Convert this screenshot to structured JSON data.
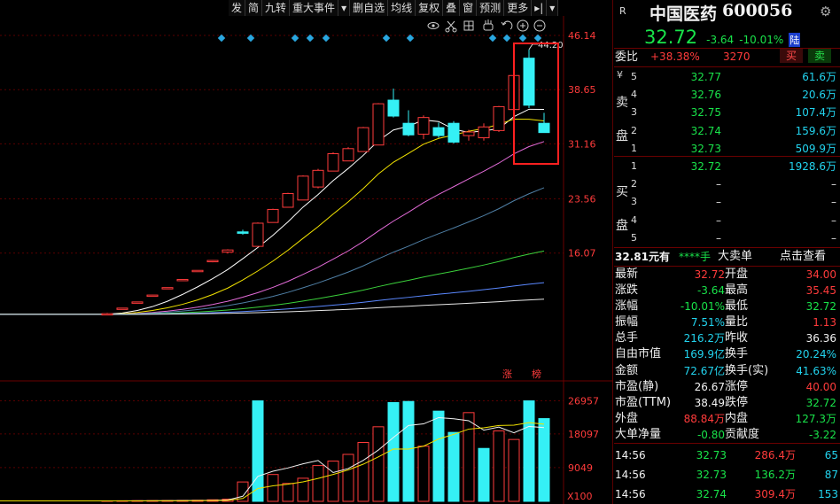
{
  "toolbar": {
    "items": [
      "发",
      "简",
      "九转",
      "重大事件",
      "▾",
      "删自选",
      "均线",
      "复权",
      "叠",
      "窗",
      "预测",
      "更多",
      "▸|",
      "▾"
    ]
  },
  "chart_data": [
    {
      "type": "candlestick",
      "title": "",
      "y_ticks": [
        "46.14",
        "38.65",
        "31.16",
        "23.56",
        "16.07"
      ],
      "ylim": [
        6.0,
        46.14
      ],
      "annotation_high": "44.20",
      "events": [
        "涨",
        "榜"
      ],
      "candles": [
        {
          "o": 7.6,
          "h": 7.8,
          "l": 7.55,
          "c": 7.7
        },
        {
          "o": 8.45,
          "h": 8.5,
          "l": 8.45,
          "c": 8.47
        },
        {
          "o": 9.3,
          "h": 9.35,
          "l": 9.3,
          "c": 9.32
        },
        {
          "o": 10.25,
          "h": 10.3,
          "l": 10.25,
          "c": 10.27
        },
        {
          "o": 11.28,
          "h": 11.32,
          "l": 11.28,
          "c": 11.3
        },
        {
          "o": 12.4,
          "h": 12.45,
          "l": 12.4,
          "c": 12.43
        },
        {
          "o": 13.65,
          "h": 13.7,
          "l": 13.65,
          "c": 13.68
        },
        {
          "o": 15.0,
          "h": 15.1,
          "l": 14.8,
          "c": 15.05
        },
        {
          "o": 16.2,
          "h": 16.6,
          "l": 16.0,
          "c": 16.5
        },
        {
          "o": 19.0,
          "h": 19.3,
          "l": 18.6,
          "c": 18.8
        },
        {
          "o": 17.0,
          "h": 20.3,
          "l": 17.0,
          "c": 20.2
        },
        {
          "o": 20.3,
          "h": 22.2,
          "l": 20.3,
          "c": 22.1
        },
        {
          "o": 22.4,
          "h": 24.4,
          "l": 22.4,
          "c": 24.3
        },
        {
          "o": 23.4,
          "h": 26.8,
          "l": 23.4,
          "c": 26.7
        },
        {
          "o": 25.2,
          "h": 27.7,
          "l": 25.0,
          "c": 27.5
        },
        {
          "o": 27.4,
          "h": 30.0,
          "l": 27.4,
          "c": 29.8
        },
        {
          "o": 28.8,
          "h": 30.7,
          "l": 28.8,
          "c": 30.5
        },
        {
          "o": 30.1,
          "h": 33.5,
          "l": 30.1,
          "c": 33.4
        },
        {
          "o": 31.0,
          "h": 36.8,
          "l": 31.0,
          "c": 36.7
        },
        {
          "o": 37.2,
          "h": 38.8,
          "l": 34.8,
          "c": 35.0
        },
        {
          "o": 34.0,
          "h": 35.8,
          "l": 32.2,
          "c": 32.4
        },
        {
          "o": 32.5,
          "h": 35.1,
          "l": 31.8,
          "c": 34.8
        },
        {
          "o": 33.4,
          "h": 34.1,
          "l": 32.0,
          "c": 32.3
        },
        {
          "o": 34.0,
          "h": 34.3,
          "l": 31.2,
          "c": 31.4
        },
        {
          "o": 32.3,
          "h": 33.1,
          "l": 31.6,
          "c": 32.8
        },
        {
          "o": 32.0,
          "h": 34.0,
          "l": 31.6,
          "c": 33.5
        },
        {
          "o": 33.0,
          "h": 36.4,
          "l": 32.8,
          "c": 36.3
        },
        {
          "o": 35.9,
          "h": 40.8,
          "l": 35.9,
          "c": 40.6
        },
        {
          "o": 43.0,
          "h": 44.2,
          "l": 36.1,
          "c": 36.5
        },
        {
          "o": 34.0,
          "h": 35.45,
          "l": 32.72,
          "c": 32.72
        }
      ],
      "ma": [
        {
          "name": "MA5",
          "color": "#ffffff"
        },
        {
          "name": "MA10",
          "color": "#f2e300"
        },
        {
          "name": "MA20",
          "color": "#e36bd8"
        },
        {
          "name": "MA30",
          "color": "#4f7fa5"
        },
        {
          "name": "MA60",
          "color": "#3bd13b"
        },
        {
          "name": "MA120",
          "color": "#5a88ff"
        },
        {
          "name": "MA250",
          "color": "#e8e8e8"
        }
      ]
    },
    {
      "type": "bar",
      "title": "",
      "y_ticks": [
        "26957",
        "18097",
        "9049"
      ],
      "unit": "X100",
      "ylim": [
        0,
        27800
      ],
      "values": [
        120,
        150,
        180,
        200,
        220,
        260,
        300,
        420,
        600,
        5200,
        26957,
        7200,
        4800,
        6200,
        9600,
        10800,
        12600,
        15800,
        20000,
        26500,
        26800,
        14800,
        24200,
        18500,
        23800,
        14200,
        18900,
        16600,
        26957,
        22200
      ],
      "colors": [
        "red",
        "red",
        "red",
        "red",
        "red",
        "red",
        "red",
        "red",
        "red",
        "red",
        "cyan",
        "red",
        "red",
        "red",
        "red",
        "red",
        "red",
        "red",
        "red",
        "cyan",
        "cyan",
        "red",
        "cyan",
        "cyan",
        "red",
        "cyan",
        "red",
        "red",
        "cyan",
        "cyan"
      ],
      "ma": [
        {
          "name": "MA5",
          "color": "#f2f2f2"
        },
        {
          "name": "MA10",
          "color": "#f2e300"
        }
      ]
    }
  ],
  "quote": {
    "r_label": "R",
    "name": "中国医药",
    "code": "600056",
    "price": "32.72",
    "change": "-3.64",
    "pct": "-10.01%",
    "market_tag": "陆",
    "webi_label": "委比",
    "webi_value": "+38.38%",
    "webi_diff": "3270",
    "buy_btn": "买",
    "sell_btn": "卖"
  },
  "ask_label": [
    "卖",
    "盘"
  ],
  "bid_label": [
    "买",
    "盘"
  ],
  "asks": [
    {
      "level": "5",
      "price": "32.77",
      "vol": "61.6万"
    },
    {
      "level": "4",
      "price": "32.76",
      "vol": "20.6万"
    },
    {
      "level": "3",
      "price": "32.75",
      "vol": "107.4万"
    },
    {
      "level": "2",
      "price": "32.74",
      "vol": "159.6万"
    },
    {
      "level": "1",
      "price": "32.73",
      "vol": "509.9万"
    }
  ],
  "yen_sign": "¥",
  "bids": [
    {
      "level": "1",
      "price": "32.72",
      "vol": "1928.6万"
    },
    {
      "level": "2",
      "price": "–",
      "vol": "–"
    },
    {
      "level": "3",
      "price": "–",
      "vol": "–"
    },
    {
      "level": "4",
      "price": "–",
      "vol": "–"
    },
    {
      "level": "5",
      "price": "–",
      "vol": "–"
    }
  ],
  "bigorder": {
    "price": "32.81元有",
    "mask": "****手",
    "label": "大卖单",
    "link": "点击查看"
  },
  "stats": [
    {
      "l1": "最新",
      "v1": "32.72",
      "c1": "red",
      "l2": "开盘",
      "v2": "34.00",
      "c2": "red"
    },
    {
      "l1": "涨跌",
      "v1": "-3.64",
      "c1": "green",
      "l2": "最高",
      "v2": "35.45",
      "c2": "red"
    },
    {
      "l1": "涨幅",
      "v1": "-10.01%",
      "c1": "green",
      "l2": "最低",
      "v2": "32.72",
      "c2": "green"
    },
    {
      "l1": "振幅",
      "v1": "7.51%",
      "c1": "cyan",
      "l2": "量比",
      "v2": "1.13",
      "c2": "red"
    },
    {
      "l1": "总手",
      "v1": "216.2万",
      "c1": "cyan",
      "l2": "昨收",
      "v2": "36.36",
      "c2": "white"
    },
    {
      "l1": "自由市值",
      "v1": "169.9亿",
      "c1": "cyan",
      "l2": "换手",
      "v2": "20.24%",
      "c2": "cyan"
    },
    {
      "l1": "金额",
      "v1": "72.67亿",
      "c1": "cyan",
      "l2": "换手(实)",
      "v2": "41.63%",
      "c2": "cyan"
    },
    {
      "l1": "市盈(静)",
      "v1": "26.67",
      "c1": "white",
      "l2": "涨停",
      "v2": "40.00",
      "c2": "red"
    },
    {
      "l1": "市盈(TTM)",
      "v1": "38.49",
      "c1": "white",
      "l2": "跌停",
      "v2": "32.72",
      "c2": "green"
    },
    {
      "l1": "外盘",
      "v1": "88.84万",
      "c1": "red",
      "l2": "内盘",
      "v2": "127.3万",
      "c2": "green"
    },
    {
      "l1": "大单净量",
      "v1": "-0.80",
      "c1": "green",
      "l2": "贡献度",
      "v2": "-3.22",
      "c2": "green"
    }
  ],
  "ticks": [
    {
      "time": "14:56",
      "price": "32.73",
      "vol": "286.4万",
      "num": "65",
      "vc": "red"
    },
    {
      "time": "14:56",
      "price": "32.73",
      "vol": "136.2万",
      "num": "87",
      "vc": "green"
    },
    {
      "time": "14:56",
      "price": "32.74",
      "vol": "309.4万",
      "num": "153",
      "vc": "red"
    }
  ],
  "icons": [
    "eye-icon",
    "scissors-icon",
    "grid-icon",
    "hand-icon",
    "undo-icon",
    "zoom-in-icon",
    "zoom-out-icon",
    "gear-icon"
  ]
}
